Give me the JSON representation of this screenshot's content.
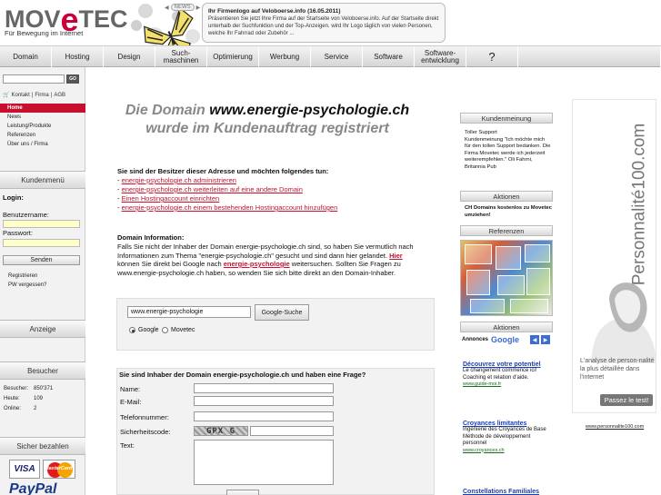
{
  "header": {
    "logo_text_a": "MOV",
    "logo_text_e": "e",
    "logo_text_b": "TEC",
    "logo_tagline": "Für Bewegung im Internet",
    "news_label": "NEWS",
    "news_title": "Ihr Firmenlogo auf Veloboerse.info (16.05.2011)",
    "news_body": "Präsentieren Sie jetzt Ihre Firma auf der Startseite von Veloboerse.info. Auf der Startseite direkt unterhalb der Suchfunktion und der Top-Anzeigen. wird Ihr Logo täglich von vielen Personen, welche Ihr Fahrrad oder Zubehör ..."
  },
  "nav": {
    "items": [
      "Domain",
      "Hosting",
      "Design",
      "Such-\nmaschinen",
      "Optimierung",
      "Werbung",
      "Service",
      "Software",
      "Software-\nentwicklung",
      "?"
    ]
  },
  "left": {
    "go_label": "GO",
    "toplinks": [
      "Kontakt",
      "Firma",
      "AGB"
    ],
    "menu": [
      "Home",
      "News",
      "Leistung/Produkte",
      "Referenzen",
      "Über uns / Firma"
    ],
    "kundenmenu_title": "Kundenmenü",
    "login_label": "Login:",
    "username_label": "Benutzername:",
    "password_label": "Passwort:",
    "send_label": "Senden",
    "register_link": "Registrieren",
    "forgot_link": "PW vergessen?",
    "anzeige_title": "Anzeige",
    "besucher_title": "Besucher",
    "stats": [
      {
        "label": "Besucher:",
        "value": "850'371"
      },
      {
        "label": "Heute:",
        "value": "109"
      },
      {
        "label": "Online:",
        "value": "2"
      }
    ],
    "pay_title": "Sicher bezahlen",
    "visa_label": "VISA",
    "mc_label": "MasterCard",
    "paypal_label": "PayPal"
  },
  "main": {
    "headline_pre": "Die Domain ",
    "headline_domain": "www.energie-psychologie.ch",
    "headline_post": " wurde im Kundenauftrag registriert",
    "owner_question": "Sie sind der Besitzer dieser Adresse und möchten folgendes tun:",
    "owner_links": [
      "energie-psychologie.ch administrieren",
      "energie-psychologie.ch weiterleiten auf eine andere Domain",
      "Einen Hostingaccount einrichten",
      "energie-psychologie.ch einem bestehenden Hostingaccount hinzufügen"
    ],
    "info_title": "Domain Information:",
    "info_text_1": "Falls Sie nicht der Inhaber der Domain energie-psychologie.ch sind, so haben Sie vermutlich nach Informationen zum Thema \"energie-psychologie.ch\" gesucht und sind dann hier gelandet. ",
    "info_hier": "Hier",
    "info_text_2": " können Sie direkt bei Google nach ",
    "info_term": "energie-psychologie",
    "info_text_3": " weitersuchen. Sollten Sie Fragen zu www.energie-psychologie.ch haben, so wenden Sie sich bitte direkt an den Domain-Inhaber.",
    "search_value": "www.energie-psychologie",
    "search_button": "Google-Suche",
    "radio_google": "Google",
    "radio_movetec": "Movetec",
    "form_title": "Sie sind Inhaber der Domain energie-psychologie.ch und haben eine Frage?",
    "form_fields": [
      "Name:",
      "E-Mail:",
      "Telefonnummer:",
      "Sicherheitscode:",
      "Text:"
    ],
    "captcha_text": "GPX G"
  },
  "right": {
    "kundenmeinung_title": "Kundenmeinung",
    "kundenmeinung_text": "Toller Support\nKundenmeinung \"Ich möchte mich für den tollen Support bedanken. Die Firma Movetec werde ich jederzeit weiterempfehlen.\" Oli Fahrni, Britannia Pub",
    "aktionen_title": "Aktionen",
    "aktionen_text": "CH Domains kostenlos zu Movetec umziehen!",
    "referenzen_title": "Referenzen",
    "aktionen2_title": "Aktionen",
    "annonces_label": "Annonces",
    "google_label": "Google",
    "ads": [
      {
        "title": "Découvrez votre potentiel",
        "desc": "Le changement commence ici! Coaching et relation d'aide.",
        "url": "www.guide-moi.fr"
      },
      {
        "title": "Croyances limitantes",
        "desc": "Ingénierie des Croyances de Base Méthode de développement personnel",
        "url": "www.croyances.ch"
      },
      {
        "title": "Constellations Familiales",
        "desc": "",
        "url": ""
      }
    ]
  },
  "banner": {
    "vertical_text": "Personnalité100.com",
    "caption": "L'analyse de person-nalité la plus détaillée dans l'internet",
    "button": "Passez le test!",
    "url": "www.personnalite100.com"
  }
}
